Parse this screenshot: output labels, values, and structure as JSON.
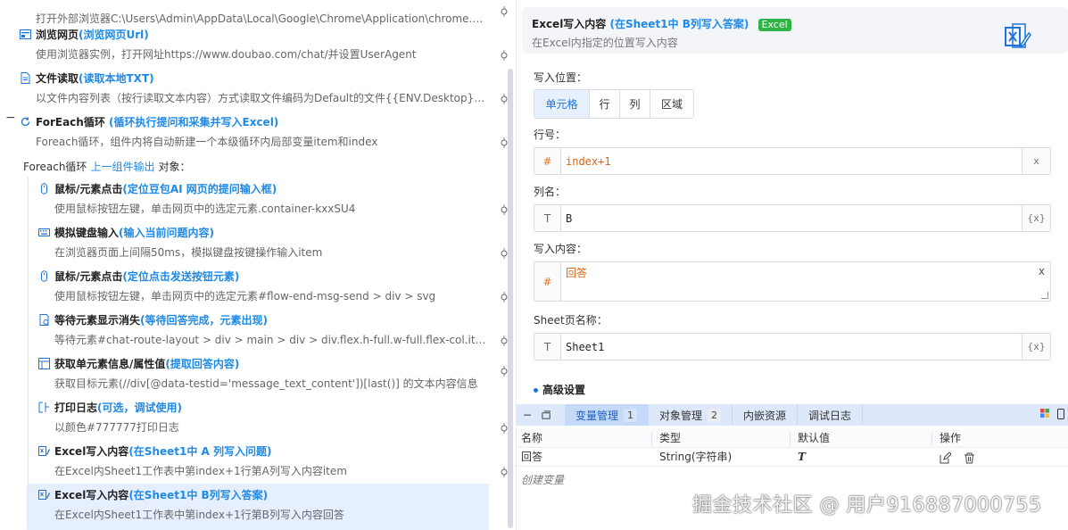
{
  "flow": {
    "steps": [
      {
        "title": "",
        "tip": "",
        "desc": "打开外部浏览器C:\\Users\\Admin\\AppData\\Local\\Google\\Chrome\\Application\\chrome.exe，设...",
        "icon": "browser-icon"
      },
      {
        "title": "浏览网页",
        "tip": "(浏览网页Url)",
        "desc": "使用浏览器实例，打开网址https://www.doubao.com/chat/并设置UserAgent",
        "icon": "browse-web-icon"
      },
      {
        "title": "文件读取",
        "tip": "(读取本地TXT)",
        "desc": "以文件内容列表（按行读取文本内容）方式读取文件编码为Default的文件{{ENV.Desktop}}\\关...",
        "icon": "file-read-icon"
      },
      {
        "title": "ForEach循环",
        "tip": "(循环执行提问和采集并写入Excel)",
        "desc": "Foreach循环，组件内将自动新建一个本级循环内局部变量item和index",
        "icon": "loop-icon"
      },
      {
        "title": "鼠标/元素点击",
        "tip": "(定位豆包AI 网页的提问输入框)",
        "desc": "使用鼠标按钮左键，单击网页中的选定元素.container-kxxSU4",
        "icon": "mouse-icon"
      },
      {
        "title": "模拟键盘输入",
        "tip": "(输入当前问题内容)",
        "desc": "在浏览器页面上间隔50ms，模拟键盘按键操作输入item",
        "icon": "keyboard-icon"
      },
      {
        "title": "鼠标/元素点击",
        "tip": "(定位点击发送按钮元素)",
        "desc": "使用鼠标按钮左键，单击网页中的选定元素#flow-end-msg-send > div > svg",
        "icon": "mouse-icon"
      },
      {
        "title": "等待元素显示消失",
        "tip": "(等待回答完成，元素出现)",
        "desc": "等待元素#chat-route-layout > div > main > div > div.flex.h-full.w-full.flex-col.items-center ...",
        "icon": "wait-icon"
      },
      {
        "title": "获取单元素信息/属性值",
        "tip": "(提取回答内容)",
        "desc": "获取目标元素(//div[@data-testid='message_text_content'])[last()] 的文本内容信息",
        "icon": "element-info-icon"
      },
      {
        "title": "打印日志",
        "tip": "(可选，调试使用)",
        "desc": "以颜色#777777打印日志",
        "icon": "log-icon"
      },
      {
        "title": "Excel写入内容",
        "tip": "(在Sheet1中 A 列写入问题)",
        "desc": "在Excel内Sheet1工作表中第index+1行第A列写入内容item",
        "icon": "excel-write-icon"
      },
      {
        "title": "Excel写入内容",
        "tip": "(在Sheet1中 B列写入答案)",
        "desc": "在Excel内Sheet1工作表中第index+1行第B列写入内容回答",
        "icon": "excel-write-icon"
      }
    ],
    "foreach_label": {
      "prefix": "Foreach循环",
      "link": "上一组件输出",
      "suffix": "对象："
    }
  },
  "panel": {
    "title": "Excel写入内容",
    "tip": "(在Sheet1中 B列写入答案)",
    "badge": "Excel",
    "subtitle": "在Excel内指定的位置写入内容",
    "position_label": "写入位置：",
    "position_options": [
      "单元格",
      "行",
      "列",
      "区域"
    ],
    "position_selected": "单元格",
    "row_label": "行号：",
    "row_value": "index+1",
    "row_type": "#",
    "row_action": "x",
    "col_label": "列名：",
    "col_value": "B",
    "col_type": "T",
    "col_action": "{x}",
    "content_label": "写入内容：",
    "content_value": "回答",
    "content_type": "#",
    "content_action": "x",
    "sheet_label": "Sheet页名称：",
    "sheet_value": "Sheet1",
    "sheet_type": "T",
    "sheet_action": "{x}",
    "advanced": "高级设置"
  },
  "bottom": {
    "tabs": [
      {
        "label": "变量管理",
        "count": "1"
      },
      {
        "label": "对象管理",
        "count": "2"
      },
      {
        "label": "内嵌资源",
        "count": ""
      },
      {
        "label": "调试日志",
        "count": ""
      }
    ],
    "table_headers": [
      "名称",
      "类型",
      "默认值",
      "操作"
    ],
    "rows": [
      {
        "name": "回答",
        "type": "String(字符串)",
        "default": "T"
      }
    ],
    "create_var": "创建变量"
  },
  "watermark": "掘金技术社区 @ 用户916887000755",
  "colors": {
    "accent": "#1e8ae6",
    "active_tab_bg": "#c5daf8",
    "excel_badge": "#2fb344",
    "selected_row": "#e6efff"
  }
}
